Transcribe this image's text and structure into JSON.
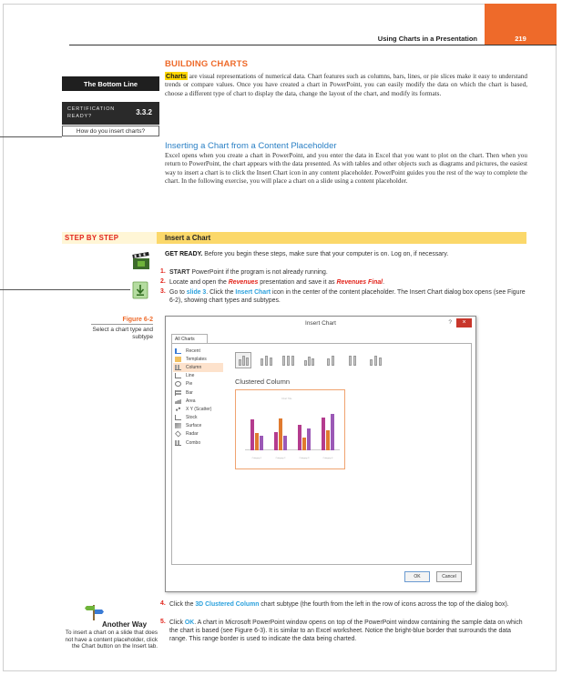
{
  "header": {
    "running_head": "Using Charts in a Presentation",
    "page_number": "219",
    "accent_color": "#ee6a2a"
  },
  "margin": {
    "bottom_line": "The Bottom Line",
    "certification_label": "CERTIFICATION READY?",
    "certification_number": "3.3.2",
    "certification_question": "How do you insert charts?"
  },
  "section": {
    "heading": "BUILDING CHARTS",
    "intro_term": "Charts",
    "intro_text": " are visual representations of numerical data. Chart features such as columns, bars, lines, or pie slices make it easy to understand trends or compare values. Once you have created a chart in PowerPoint, you can easily modify the data on which the chart is based, choose a different type of chart to display the data, change the layout of the chart, and modify its formats.",
    "subheading": "Inserting a Chart from a Content Placeholder",
    "sub_text": "Excel opens when you create a chart in PowerPoint, and you enter the data in Excel that you want to plot on the chart. Then when you return to PowerPoint, the chart appears with the data presented. As with tables and other objects such as diagrams and pictures, the easiest way to insert a chart is to click the Insert Chart icon in any content placeholder. PowerPoint guides you the rest of the way to complete the chart. In the following exercise, you will place a chart on a slide using a content placeholder."
  },
  "step_bar": {
    "label": "STEP BY STEP",
    "title": "Insert a Chart"
  },
  "get_ready": {
    "lead": "GET READY.",
    "text": " Before you begin these steps, make sure that your computer is on. Log on, if necessary."
  },
  "steps": {
    "s1": {
      "num": "1.",
      "bold": "START",
      "rest": " PowerPoint if the program is not already running."
    },
    "s2": {
      "num": "2.",
      "a": "Locate and open the ",
      "file1": "Revenues",
      "b": " presentation and save it as ",
      "file2": "Revenues Final",
      "c": "."
    },
    "s3": {
      "num": "3.",
      "a": "Go to ",
      "slide": "slide 3",
      "b": ". Click the ",
      "cmd": "Insert Chart",
      "c": " icon in the center of the content placeholder. The Insert Chart dialog box opens (see Figure 6-2), showing chart types and subtypes."
    },
    "s4": {
      "num": "4.",
      "a": "Click the ",
      "cmd": "3D Clustered Column",
      "b": " chart subtype (the fourth from the left in the row of icons across the top of the dialog box)."
    },
    "s5": {
      "num": "5.",
      "a": "Click ",
      "cmd": "OK",
      "b": ". A chart in Microsoft PowerPoint window opens on top of the PowerPoint window containing the sample data on which the chart is based (see Figure 6-3). It is similar to an Excel worksheet. Notice the bright-blue border that surrounds the data range. This range border is used to indicate the data being charted."
    }
  },
  "figure": {
    "number": "Figure 6-2",
    "caption": "Select a chart type and subtype"
  },
  "dialog": {
    "title": "Insert Chart",
    "help": "?",
    "close": "×",
    "tab": "All Charts",
    "types": [
      "Recent",
      "Templates",
      "Column",
      "Line",
      "Pie",
      "Bar",
      "Area",
      "X Y (Scatter)",
      "Stock",
      "Surface",
      "Radar",
      "Combo"
    ],
    "selected_type": "Column",
    "preview_title": "Clustered Column",
    "preview_chart_title": "Chart Title",
    "preview_categories": [
      "Category 1",
      "Category 2",
      "Category 3",
      "Category 4"
    ],
    "preview_values": {
      "series1": [
        4.3,
        2.5,
        3.5,
        4.5
      ],
      "series2": [
        2.4,
        4.4,
        1.8,
        2.8
      ],
      "series3": [
        2,
        2,
        3,
        5
      ]
    },
    "series_colors": [
      "#b43c8e",
      "#e07a2f",
      "#9b59b6"
    ],
    "ok": "OK",
    "cancel": "Cancel"
  },
  "another_way": {
    "title": "Another Way",
    "text": "To insert a chart on a slide that does not have a content placeholder, click the Chart button on the Insert tab."
  }
}
